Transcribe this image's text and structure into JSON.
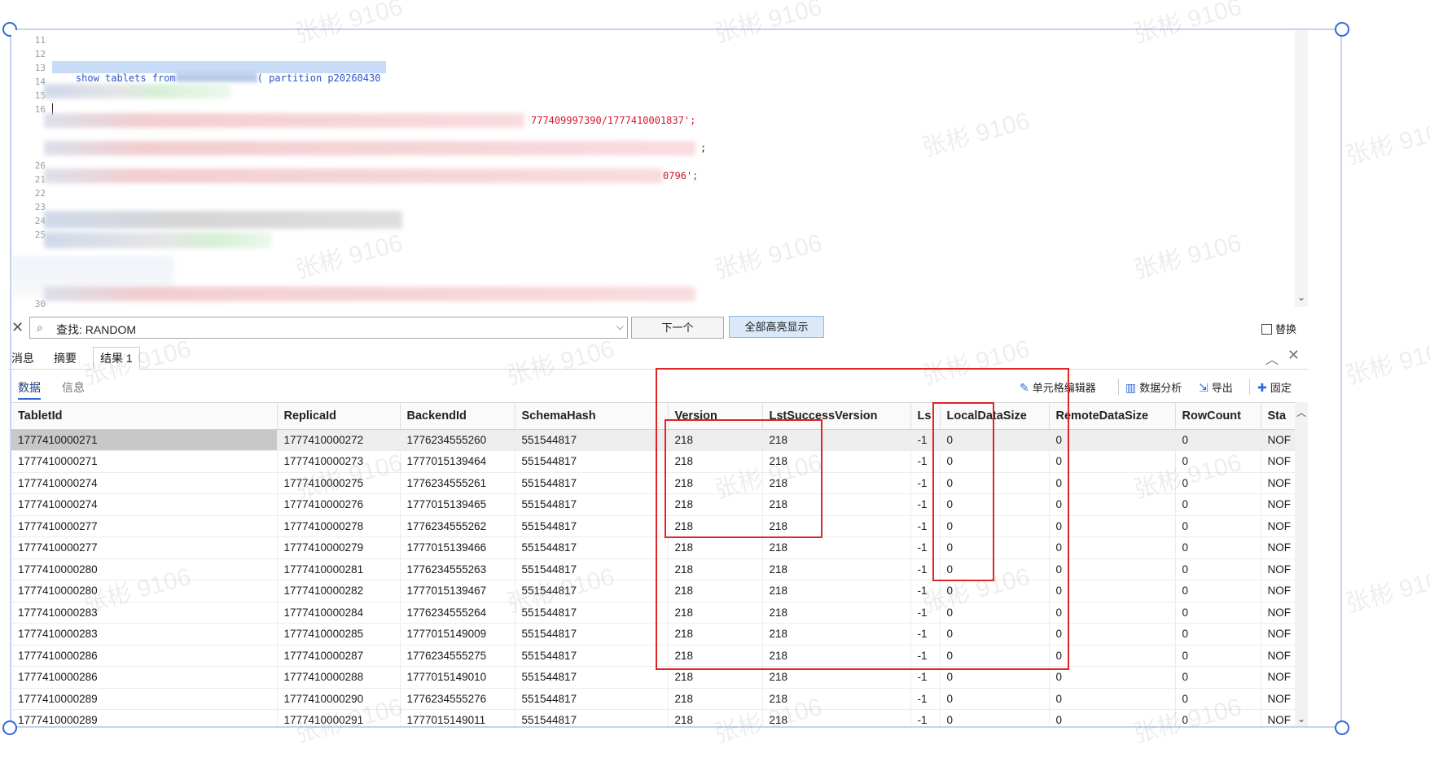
{
  "editor": {
    "line_numbers": [
      "11",
      "12",
      "13",
      "14",
      "15",
      "16",
      "26",
      "21",
      "22",
      "23",
      "24",
      "25",
      "30"
    ],
    "statement_prefix": "show tablets from",
    "statement_suffix": "( partition p20260430",
    "line16_tail": "777409997390/1777410001837';",
    "line17_tail": ";",
    "line21_tail": "0796';"
  },
  "findbar": {
    "search_text": "查找: RANDOM",
    "next_button": "下一个",
    "highlight_all_button": "全部高亮显示",
    "replace_label": "替换"
  },
  "result_tabs": [
    "消息",
    "摘要",
    "结果 1"
  ],
  "subtabs": {
    "data": "数据",
    "info": "信息"
  },
  "toolbar": {
    "cell_editor": "单元格编辑器",
    "data_analysis": "数据分析",
    "export": "导出",
    "pin": "固定"
  },
  "grid": {
    "columns": [
      "TabletId",
      "ReplicaId",
      "BackendId",
      "SchemaHash",
      "Version",
      "LstSuccessVersion",
      "Ls",
      "LocalDataSize",
      "RemoteDataSize",
      "RowCount",
      "Sta"
    ],
    "rows": [
      [
        "1777410000271",
        "1777410000272",
        "1776234555260",
        "551544817",
        "218",
        "218",
        "-1",
        "0",
        "0",
        "0",
        "NOF"
      ],
      [
        "1777410000271",
        "1777410000273",
        "1777015139464",
        "551544817",
        "218",
        "218",
        "-1",
        "0",
        "0",
        "0",
        "NOF"
      ],
      [
        "1777410000274",
        "1777410000275",
        "1776234555261",
        "551544817",
        "218",
        "218",
        "-1",
        "0",
        "0",
        "0",
        "NOF"
      ],
      [
        "1777410000274",
        "1777410000276",
        "1777015139465",
        "551544817",
        "218",
        "218",
        "-1",
        "0",
        "0",
        "0",
        "NOF"
      ],
      [
        "1777410000277",
        "1777410000278",
        "1776234555262",
        "551544817",
        "218",
        "218",
        "-1",
        "0",
        "0",
        "0",
        "NOF"
      ],
      [
        "1777410000277",
        "1777410000279",
        "1777015139466",
        "551544817",
        "218",
        "218",
        "-1",
        "0",
        "0",
        "0",
        "NOF"
      ],
      [
        "1777410000280",
        "1777410000281",
        "1776234555263",
        "551544817",
        "218",
        "218",
        "-1",
        "0",
        "0",
        "0",
        "NOF"
      ],
      [
        "1777410000280",
        "1777410000282",
        "1777015139467",
        "551544817",
        "218",
        "218",
        "-1",
        "0",
        "0",
        "0",
        "NOF"
      ],
      [
        "1777410000283",
        "1777410000284",
        "1776234555264",
        "551544817",
        "218",
        "218",
        "-1",
        "0",
        "0",
        "0",
        "NOF"
      ],
      [
        "1777410000283",
        "1777410000285",
        "1777015149009",
        "551544817",
        "218",
        "218",
        "-1",
        "0",
        "0",
        "0",
        "NOF"
      ],
      [
        "1777410000286",
        "1777410000287",
        "1776234555275",
        "551544817",
        "218",
        "218",
        "-1",
        "0",
        "0",
        "0",
        "NOF"
      ],
      [
        "1777410000286",
        "1777410000288",
        "1777015149010",
        "551544817",
        "218",
        "218",
        "-1",
        "0",
        "0",
        "0",
        "NOF"
      ],
      [
        "1777410000289",
        "1777410000290",
        "1776234555276",
        "551544817",
        "218",
        "218",
        "-1",
        "0",
        "0",
        "0",
        "NOF"
      ],
      [
        "1777410000289",
        "1777410000291",
        "1777015149011",
        "551544817",
        "218",
        "218",
        "-1",
        "0",
        "0",
        "0",
        "NOF"
      ]
    ],
    "selected_row": 0
  },
  "watermark": "张彬 9106",
  "colors": {
    "annotation": "#e02424",
    "accent": "#2f6bd8",
    "selection": "#c9dcf7"
  }
}
